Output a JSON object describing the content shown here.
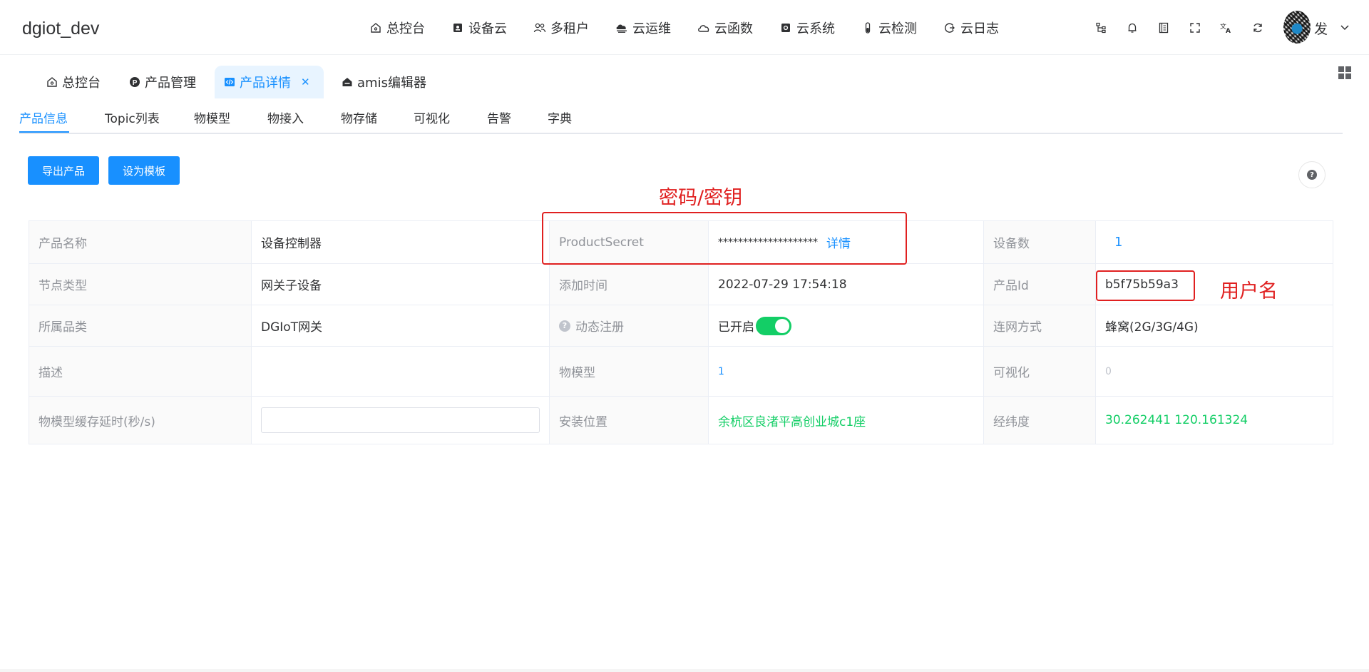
{
  "app": {
    "title": "dgiot_dev"
  },
  "nav": [
    {
      "label": "总控台",
      "icon": "home-icon"
    },
    {
      "label": "设备云",
      "icon": "device-icon"
    },
    {
      "label": "多租户",
      "icon": "users-icon"
    },
    {
      "label": "云运维",
      "icon": "cloud-ops-icon"
    },
    {
      "label": "云函数",
      "icon": "cloud-function-icon"
    },
    {
      "label": "云系统",
      "icon": "system-icon"
    },
    {
      "label": "云检测",
      "icon": "test-tube-icon"
    },
    {
      "label": "云日志",
      "icon": "log-icon"
    }
  ],
  "user": {
    "name": "发"
  },
  "tabs": [
    {
      "label": "总控台",
      "icon": "home-icon"
    },
    {
      "label": "产品管理",
      "icon": "p-circle-icon"
    },
    {
      "label": "产品详情",
      "icon": "code-icon",
      "active": true
    },
    {
      "label": "amis编辑器",
      "icon": "home-filled-icon"
    }
  ],
  "content_tabs": [
    "产品信息",
    "Topic列表",
    "物模型",
    "物接入",
    "物存储",
    "可视化",
    "告警",
    "字典"
  ],
  "buttons": {
    "export": "导出产品",
    "template": "设为模板"
  },
  "table": {
    "product_name_label": "产品名称",
    "product_name": "设备控制器",
    "secret_label": "ProductSecret",
    "secret_value": "********************",
    "secret_detail": "详情",
    "device_count_label": "设备数",
    "device_count": "1",
    "node_type_label": "节点类型",
    "node_type": "网关子设备",
    "add_time_label": "添加时间",
    "add_time": "2022-07-29 17:54:18",
    "product_id_label": "产品Id",
    "product_id": "b5f75b59a3",
    "category_label": "所属品类",
    "category": "DGIoT网关",
    "dynamic_reg_label": "动态注册",
    "dynamic_reg_value": "已开启",
    "network_label": "连网方式",
    "network": "蜂窝(2G/3G/4G)",
    "desc_label": "描述",
    "desc": "",
    "thing_model_label": "物模型",
    "thing_model": "1",
    "visual_label": "可视化",
    "visual": "0",
    "cache_delay_label": "物模型缓存延时(秒/s)",
    "cache_delay_value": "",
    "location_label": "安装位置",
    "location": "余杭区良渚平高创业城c1座",
    "latlng_label": "经纬度",
    "latlng": "30.262441 120.161324"
  },
  "annotations": {
    "secret": "密码/密钥",
    "username": "用户名"
  },
  "colors": {
    "accent": "#1890ff",
    "success": "#13ce66",
    "annotation": "#e02020"
  }
}
